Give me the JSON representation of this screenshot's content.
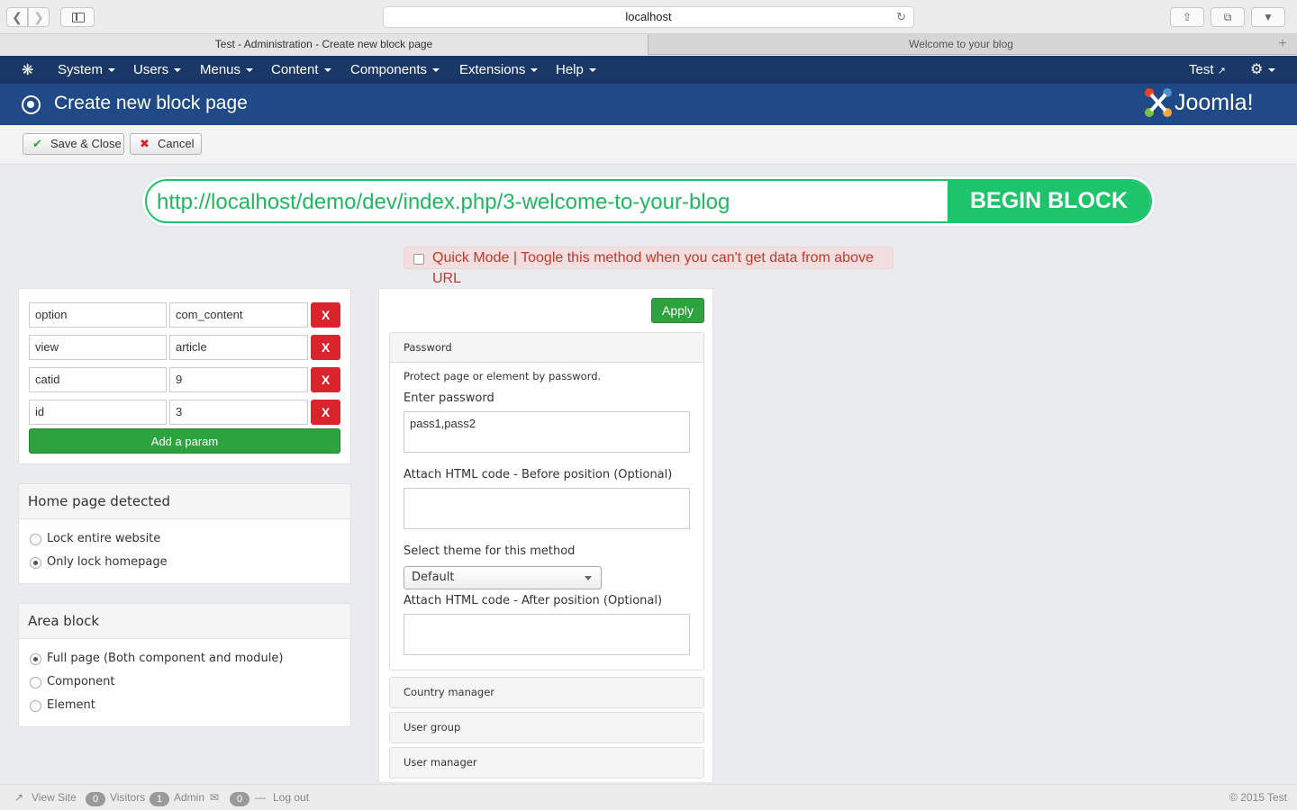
{
  "browser": {
    "url": "localhost",
    "tabs": [
      {
        "title": "Test - Administration - Create new block page"
      },
      {
        "title": "Welcome to your blog"
      }
    ]
  },
  "topnav": {
    "menu": [
      "System",
      "Users",
      "Menus",
      "Content",
      "Components",
      "Extensions",
      "Help"
    ],
    "user": "Test"
  },
  "header": {
    "title": "Create new block page",
    "logo_text": "Joomla!"
  },
  "toolbar": {
    "save_label": "Save & Close",
    "cancel_label": "Cancel"
  },
  "block": {
    "url": "http://localhost/demo/dev/index.php/3-welcome-to-your-blog",
    "begin_label": "BEGIN BLOCK",
    "quick_mode_label": "Quick Mode | Toogle this method when you can't get data from above URL",
    "quick_mode_checked": false
  },
  "params": {
    "rows": [
      {
        "key": "option",
        "value": "com_content",
        "remove": "X"
      },
      {
        "key": "view",
        "value": "article",
        "remove": "X"
      },
      {
        "key": "catid",
        "value": "9",
        "remove": "X"
      },
      {
        "key": "id",
        "value": "3",
        "remove": "X"
      }
    ],
    "add_label": "Add a param"
  },
  "home_page": {
    "title": "Home page detected",
    "options": [
      {
        "label": "Lock entire website",
        "selected": false
      },
      {
        "label": "Only lock homepage",
        "selected": true
      }
    ]
  },
  "area_block": {
    "title": "Area block",
    "options": [
      {
        "label": "Full page (Both component and module)",
        "selected": true
      },
      {
        "label": "Component",
        "selected": false
      },
      {
        "label": "Element",
        "selected": false
      }
    ]
  },
  "methods": {
    "apply_label": "Apply",
    "password": {
      "title": "Password",
      "description": "Protect page or element by password.",
      "enter_label": "Enter password",
      "value": "pass1,pass2",
      "before_label": "Attach HTML code - Before position (Optional)",
      "before_value": "",
      "theme_label": "Select theme for this method",
      "theme_value": "Default",
      "after_label": "Attach HTML code - After position (Optional)",
      "after_value": ""
    },
    "collapsed": [
      "Country manager",
      "User group",
      "User manager"
    ]
  },
  "footer": {
    "view_site": "View Site",
    "visitors_count": "0",
    "visitors_label": "Visitors",
    "admin_count": "1",
    "admin_label": "Admin",
    "messages_count": "0",
    "logout": "Log out",
    "copyright": "© 2015 Test"
  },
  "colors": {
    "nav_bg": "#1a3867",
    "header_bg": "#1f4a87",
    "accent_green": "#1dc46a",
    "danger": "#d9232d"
  }
}
